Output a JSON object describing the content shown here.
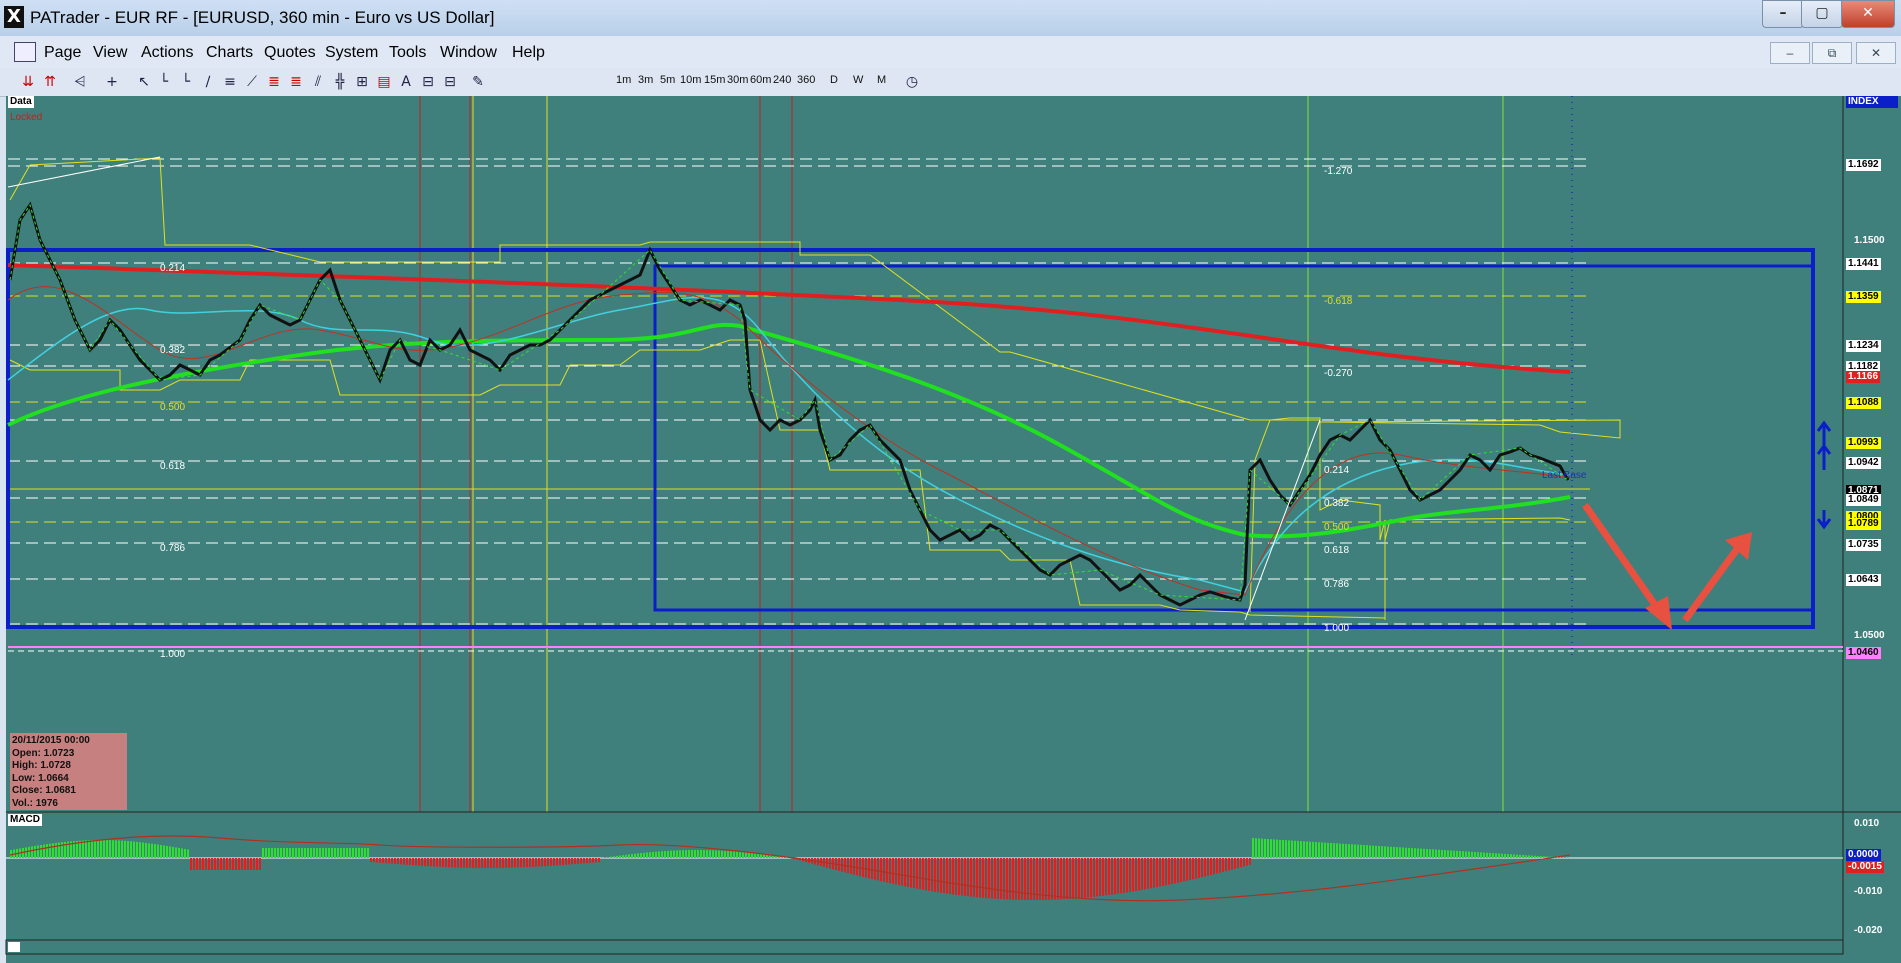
{
  "window": {
    "title": "PATrader - EUR RF - [EURUSD, 360 min - Euro vs US Dollar]",
    "app_icon": "X"
  },
  "window_controls": {
    "minimize": "–",
    "maximize": "▢",
    "close": "✕"
  },
  "mdi_controls": {
    "minimize": "–",
    "restore": "⧉",
    "close": "✕"
  },
  "menu": [
    "Page",
    "View",
    "Actions",
    "Charts",
    "Quotes",
    "System",
    "Tools",
    "Window",
    "Help"
  ],
  "toolbar": {
    "tools": [
      "chart-icon",
      "crosshair-icon",
      "arrow-icon",
      "line-icon",
      "fib-icon",
      "channel-icon",
      "text-icon",
      "pen-icon"
    ],
    "timeframes": [
      "1m",
      "3m",
      "5m",
      "10m",
      "15m",
      "30m",
      "60m",
      "240",
      "360"
    ],
    "periods": [
      "D",
      "W",
      "M"
    ],
    "clock_icon": "clock-icon"
  },
  "chart_labels": {
    "data": "Data",
    "locked": "Locked",
    "index": "INDEX",
    "macd": "MACD",
    "base_label": "Last Base"
  },
  "price_axis": [
    "1.1692",
    "1.1500",
    "1.1441",
    "1.1359",
    "1.1234",
    "1.1182",
    "1.1166",
    "1.1088",
    "1.0993",
    "1.0942",
    "1.0871",
    "1.0849",
    "1.0800",
    "1.0789",
    "1.0735",
    "1.0643",
    "1.0500",
    "1.0460"
  ],
  "macd_axis": [
    "0.010",
    "0.0000",
    "-0.0015",
    "-0.010",
    "-0.020"
  ],
  "fib_left": [
    "0.214",
    "0.382",
    "0.500",
    "0.618",
    "0.786",
    "1.000"
  ],
  "fib_right": [
    "-1.270",
    "-0.618",
    "-0.270",
    "0.214",
    "0.382",
    "0.500",
    "0.618",
    "0.786",
    "1.000"
  ],
  "ohlc": {
    "date": "20/11/2015 00:00",
    "open": "Open: 1.0723",
    "high": "High: 1.0728",
    "low": "Low: 1.0664",
    "close": "Close: 1.0681",
    "vol": "Vol.: 1976"
  },
  "colors": {
    "chart_bg": "#40807c",
    "support_box": "#0a1fc8",
    "ma_red": "#e02020",
    "ma_green": "#20e020",
    "ma_cyan": "#40d0e0",
    "highlight_yellow": "#ffff00",
    "pink_line": "#ff80ff"
  }
}
